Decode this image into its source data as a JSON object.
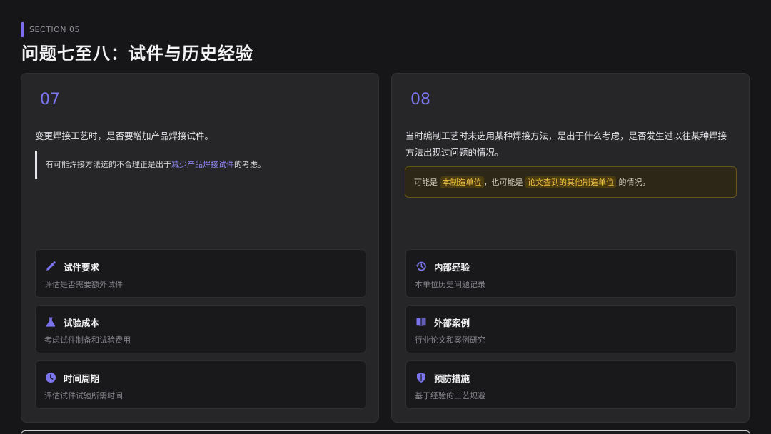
{
  "header": {
    "section_tag": "SECTION 05",
    "title": "问题七至八：试件与历史经验"
  },
  "left": {
    "number": "07",
    "question": "变更焊接工艺时，是否要增加产品焊接试件。",
    "quote": {
      "before": "有可能焊接方法选的不合理正是出于",
      "highlight": "减少产品焊接试件",
      "after": "的考虑。"
    },
    "items": [
      {
        "icon": "pencil-icon",
        "title": "试件要求",
        "subtitle": "评估是否需要额外试件"
      },
      {
        "icon": "flask-icon",
        "title": "试验成本",
        "subtitle": "考虑试件制备和试验费用"
      },
      {
        "icon": "clock-icon",
        "title": "时间周期",
        "subtitle": "评估试件试验所需时间"
      }
    ]
  },
  "right": {
    "number": "08",
    "question": "当时编制工艺时未选用某种焊接方法，是出于什么考虑，是否发生过以往某种焊接方法出现过问题的情况。",
    "note": {
      "p1": "可能是",
      "chip1": "本制造单位",
      "p2": "，也可能是",
      "chip2": "论文查到的其他制造单位",
      "p3": "的情况。"
    },
    "items": [
      {
        "icon": "history-icon",
        "title": "内部经验",
        "subtitle": "本单位历史问题记录"
      },
      {
        "icon": "book-icon",
        "title": "外部案例",
        "subtitle": "行业论文和案例研究"
      },
      {
        "icon": "shield-icon",
        "title": "预防措施",
        "subtitle": "基于经验的工艺规避"
      }
    ]
  },
  "colors": {
    "accent": "#7b74ee",
    "highlight_text": "#f2c13c",
    "background": "#161618",
    "card": "#262628"
  }
}
